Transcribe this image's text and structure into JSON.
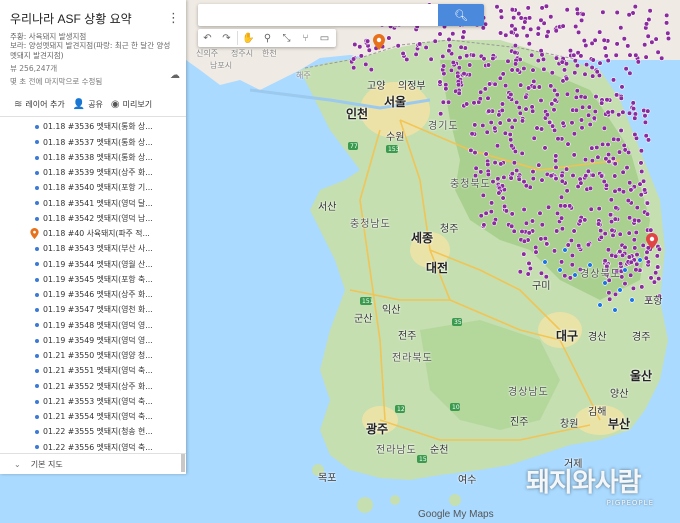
{
  "panel": {
    "title": "우리나라 ASF 상황 요약",
    "desc_line1": "주황: 사육돼지 발생지점",
    "desc_line2": "보라: 양성멧돼지 발견지점(파랑: 최근 한 달간 양성",
    "desc_line3": "멧돼지 발견지점)",
    "views": "뷰 256,247개",
    "edited": "몇 초 전에 마지막으로 수정됨",
    "actions": {
      "add_layer": "레이어 추가",
      "share": "공유",
      "preview": "미리보기"
    },
    "items": [
      {
        "label": "01.18 #3536 멧돼지(통화 상...",
        "type": "dot"
      },
      {
        "label": "01.18 #3537 멧돼지(통화 상...",
        "type": "dot"
      },
      {
        "label": "01.18 #3538 멧돼지(통화 상...",
        "type": "dot"
      },
      {
        "label": "01.18 #3539 멧돼지(상주 화...",
        "type": "dot"
      },
      {
        "label": "01.18 #3540 멧돼지(포항 기...",
        "type": "dot"
      },
      {
        "label": "01.18 #3541 멧돼지(영덕 달...",
        "type": "dot"
      },
      {
        "label": "01.18 #3542 멧돼지(영덕 남...",
        "type": "dot"
      },
      {
        "label": "01.18 #40 사육돼지(파주 적...",
        "type": "pin"
      },
      {
        "label": "01.18 #3543 멧돼지(부산 사...",
        "type": "dot"
      },
      {
        "label": "01.19 #3544 멧돼지(영월 산...",
        "type": "dot"
      },
      {
        "label": "01.19 #3545 멧돼지(포항 축...",
        "type": "dot"
      },
      {
        "label": "01.19 #3546 멧돼지(상주 화...",
        "type": "dot"
      },
      {
        "label": "01.19 #3547 멧돼지(영천 화...",
        "type": "dot"
      },
      {
        "label": "01.19 #3548 멧돼지(영덕 영...",
        "type": "dot"
      },
      {
        "label": "01.19 #3549 멧돼지(영덕 영...",
        "type": "dot"
      },
      {
        "label": "01.21 #3550 멧돼지(영양 청...",
        "type": "dot"
      },
      {
        "label": "01.21 #3551 멧돼지(영덕 축...",
        "type": "dot"
      },
      {
        "label": "01.21 #3552 멧돼지(상주 화...",
        "type": "dot"
      },
      {
        "label": "01.21 #3553 멧돼지(영덕 축...",
        "type": "dot"
      },
      {
        "label": "01.21 #3554 멧돼지(영덕 축...",
        "type": "dot"
      },
      {
        "label": "01.22 #3555 멧돼지(청송 현...",
        "type": "dot"
      },
      {
        "label": "01.22 #3556 멧돼지(영덕 축...",
        "type": "dot"
      }
    ],
    "basemap": "기본 지도"
  },
  "search": {
    "placeholder": ""
  },
  "map_labels": {
    "seoul": "서울",
    "incheon": "인천",
    "goyang": "고양",
    "uijeongbu": "의정부",
    "suwon": "수원",
    "gyeonggi": "경기도",
    "chungbuk": "충청북도",
    "seosan": "서산",
    "chungnam": "충청남도",
    "sejong": "세종",
    "cheongju": "청주",
    "daejeon": "대전",
    "gumi": "구미",
    "gyeongbuk": "경상북도",
    "pohang": "포항",
    "daegu": "대구",
    "gyeongsan": "경산",
    "gyeongju": "경주",
    "gunsan": "군산",
    "iksan": "익산",
    "jeonju": "전주",
    "jeonbuk": "전라북도",
    "ulsan": "울산",
    "gyeongnam": "경상남도",
    "yangsan": "양산",
    "gimhae": "김해",
    "busan": "부산",
    "jinju": "진주",
    "changwon": "창원",
    "geoje": "거제",
    "gwangju": "광주",
    "suncheon": "순천",
    "jeonnam": "전라남도",
    "yeosu": "여수",
    "mokpo": "목포",
    "sinuiju": "신의주",
    "haeju": "해주",
    "jp1": "정주시",
    "jp2": "한천",
    "jp3": "남포시",
    "watermark_main": "돼지와사람",
    "watermark_sub": "PIGPEOPLE",
    "credit": "Google My Maps"
  },
  "accent": "#4a89dc",
  "colors": {
    "purple": "#8a2b9e",
    "blue": "#1a73e8",
    "orange": "#e8711c",
    "red": "#e04444"
  },
  "icons": [
    "more-vert-icon",
    "cloud-icon",
    "layers-icon",
    "person-add-icon",
    "eye-icon",
    "search-icon",
    "undo-icon",
    "redo-icon",
    "hand-icon",
    "marker-icon",
    "line-icon",
    "route-icon",
    "ruler-icon",
    "chevron-down-icon"
  ]
}
